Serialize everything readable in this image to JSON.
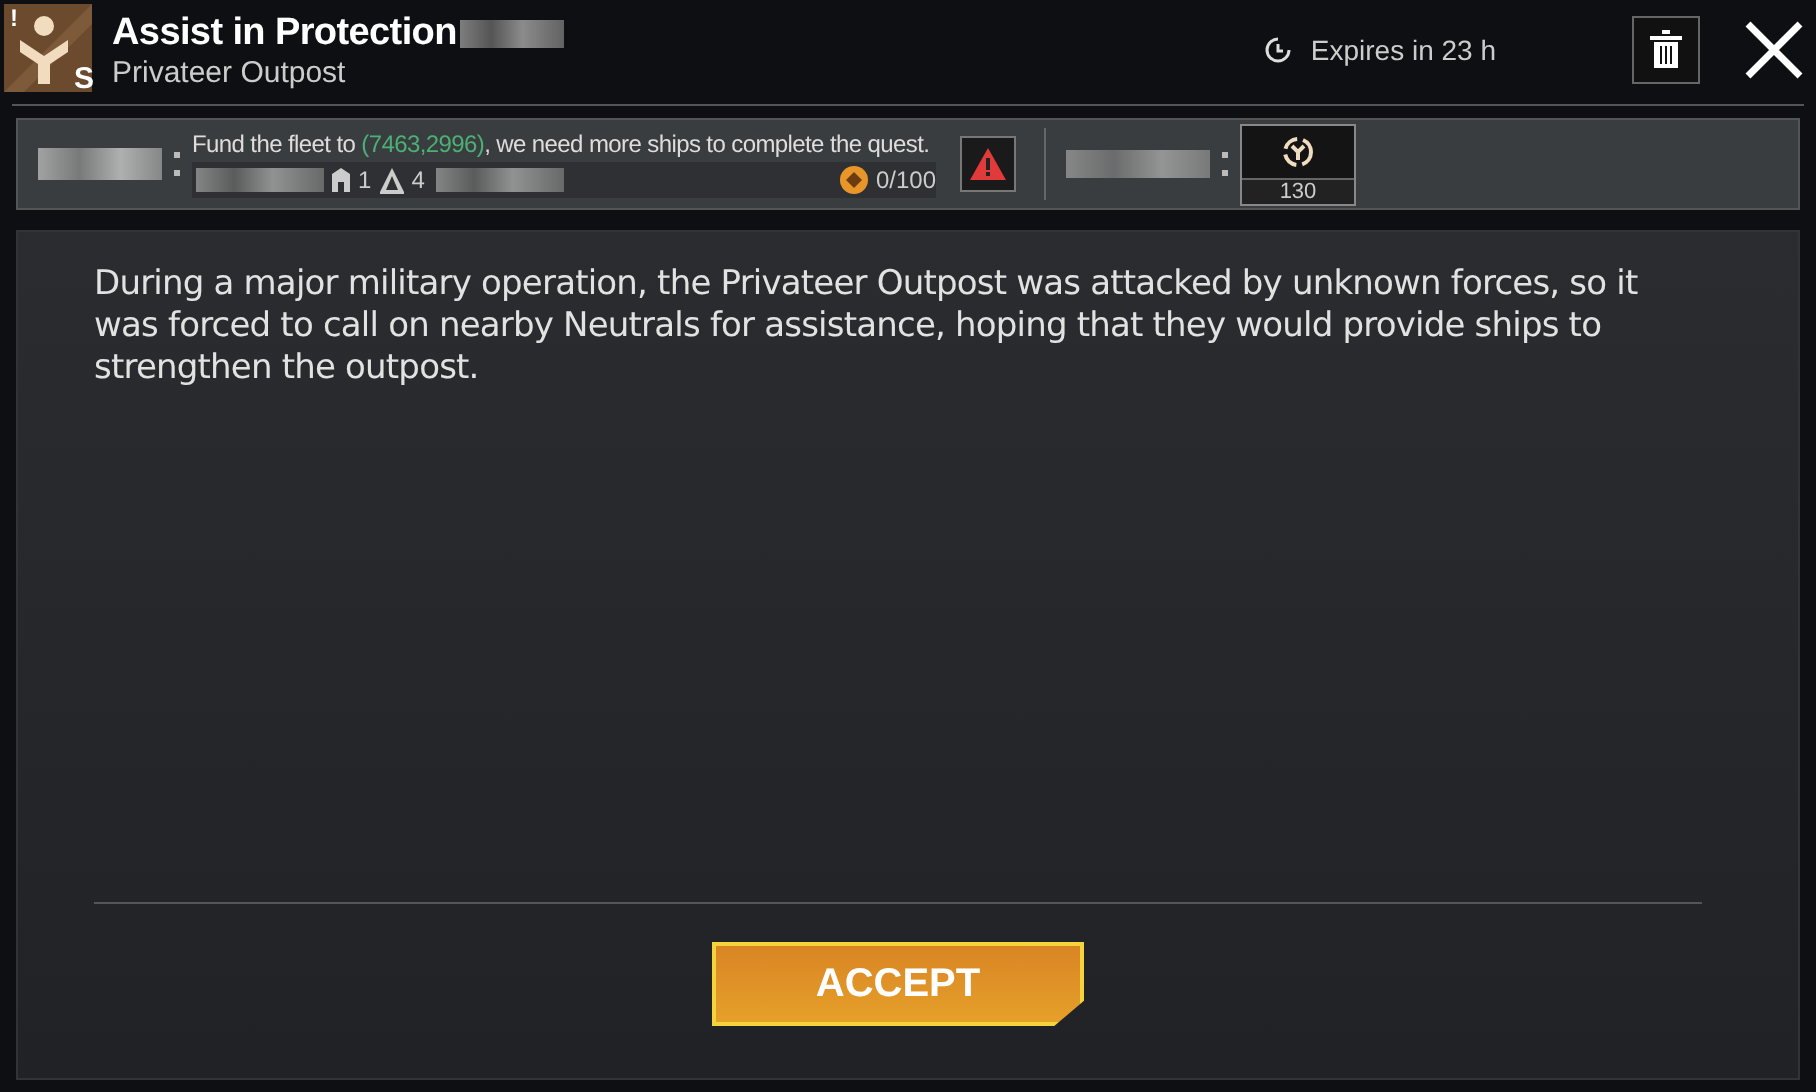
{
  "header": {
    "title": "Assist in Protection",
    "subtitle": "Privateer Outpost",
    "badge_letter": "S",
    "badge_mark": "!",
    "expires": "Expires in 23 h"
  },
  "objective": {
    "message_parts": [
      {
        "text": "Fund the fleet to ",
        "highlight": false
      },
      {
        "text": "(7463,2996)",
        "highlight": true
      },
      {
        "text": ", we need more ships to complete the quest.",
        "highlight": false
      }
    ],
    "building_level": "1",
    "fleet_count": "4",
    "progress": "0/100",
    "warning": true,
    "reward_count": "130"
  },
  "description": "During a major military operation, the Privateer Outpost was attacked by unknown forces, so it was forced to call on nearby Neutrals for assistance, hoping that they would provide ships to strengthen the outpost.",
  "accept_button": "ACCEPT"
}
